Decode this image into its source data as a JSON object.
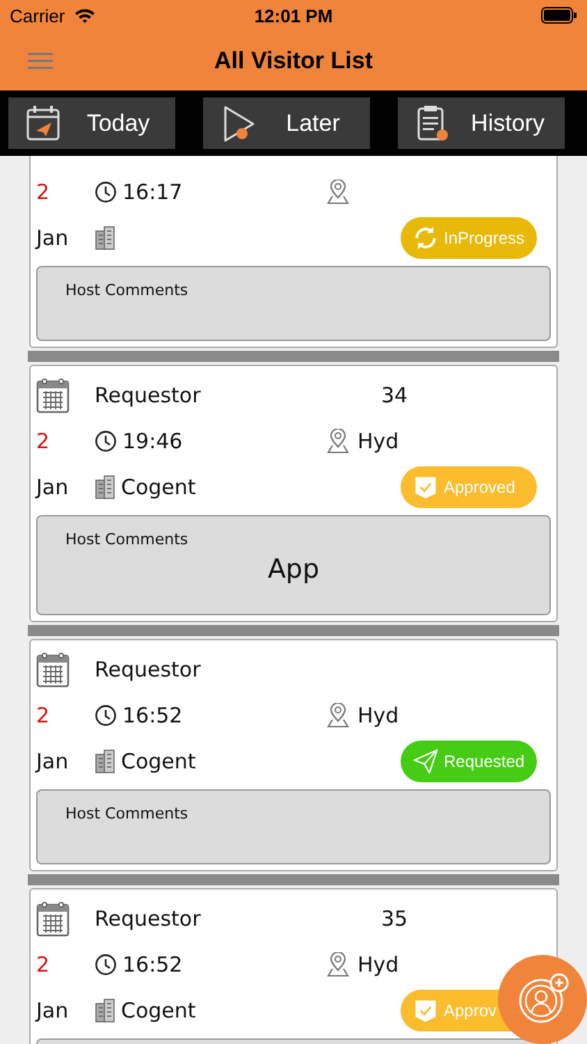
{
  "status_bar": {
    "carrier": "Carrier",
    "time": "12:01 PM"
  },
  "nav": {
    "title": "All Visitor List"
  },
  "tabs": [
    {
      "label": "Today"
    },
    {
      "label": "Later"
    },
    {
      "label": "History"
    }
  ],
  "visits": [
    {
      "count": "2",
      "time": "16:17",
      "day": "Jan",
      "status": {
        "kind": "inprogress",
        "label": "InProgress",
        "color": "#e9b90a"
      },
      "comments_label": "Host Comments"
    },
    {
      "requestor": "Requestor",
      "number": "34",
      "count": "2",
      "time": "19:46",
      "location": "Hyd",
      "day": "Jan",
      "company": "Cogent",
      "status": {
        "kind": "approved",
        "label": "Approved",
        "color": "#fbbc2e"
      },
      "comments_label": "Host Comments",
      "comments": "App"
    },
    {
      "requestor": "Requestor",
      "count": "2",
      "time": "16:52",
      "location": "Hyd",
      "day": "Jan",
      "company": "Cogent",
      "status": {
        "kind": "requested",
        "label": "Requested",
        "color": "#46cc14"
      },
      "comments_label": "Host Comments"
    },
    {
      "requestor": "Requestor",
      "number": "35",
      "count": "2",
      "time": "16:52",
      "location": "Hyd",
      "day": "Jan",
      "company": "Cogent",
      "status": {
        "kind": "approved",
        "label": "Approv",
        "color": "#fbbc2e"
      }
    }
  ]
}
